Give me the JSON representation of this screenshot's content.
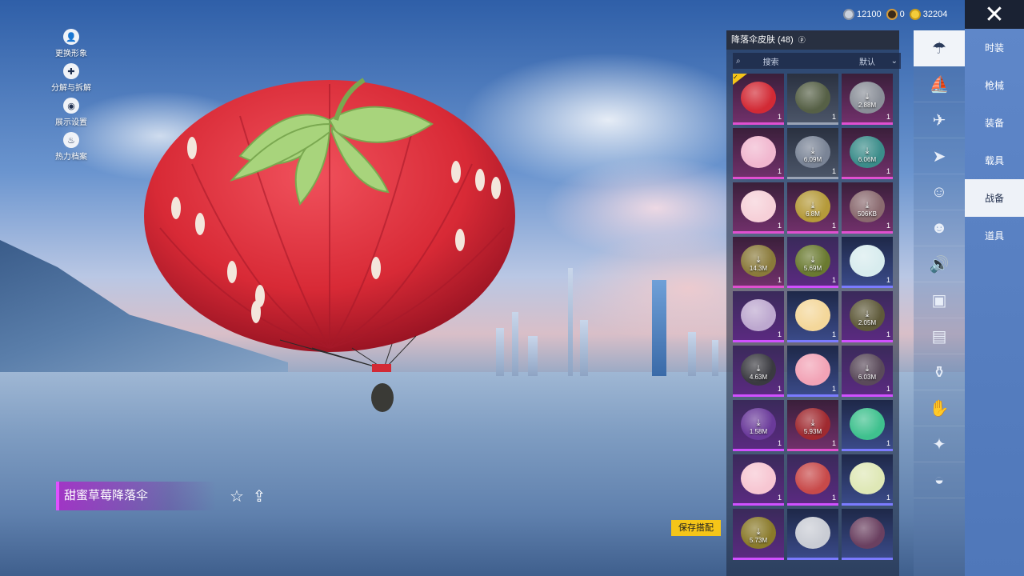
{
  "currency": [
    {
      "icon": "silver-coin-icon",
      "value": "12100",
      "color": "#c9d1dd"
    },
    {
      "icon": "bronze-coin-icon",
      "value": "0",
      "color": "#d49a3a"
    },
    {
      "icon": "gold-coin-icon",
      "value": "32204",
      "color": "#f3cc3a"
    }
  ],
  "left_menu": [
    {
      "icon": "avatar-icon",
      "label": "更换形象"
    },
    {
      "icon": "puzzle-icon",
      "label": "分解与拆解"
    },
    {
      "icon": "eye-icon",
      "label": "展示设置"
    },
    {
      "icon": "fire-icon",
      "label": "热力档案"
    }
  ],
  "item": {
    "name": "甜蜜草莓降落伞"
  },
  "save_button": "保存搭配",
  "panel": {
    "title": "降落伞皮肤 (48)",
    "search_placeholder": "搜索",
    "sort_label": "默认"
  },
  "skins": [
    {
      "style": "magenta",
      "color": "#d22a35",
      "count": "1",
      "download": "",
      "selected": true
    },
    {
      "style": "grey",
      "color": "#566046",
      "count": "1",
      "download": ""
    },
    {
      "style": "magenta",
      "color": "#8a8f98",
      "count": "1",
      "download": "2.88M"
    },
    {
      "style": "magenta",
      "color": "#f1b7cf",
      "count": "1",
      "download": ""
    },
    {
      "style": "grey",
      "color": "#7a8496",
      "count": "1",
      "download": "6.09M"
    },
    {
      "style": "magenta",
      "color": "#3b8d8a",
      "count": "1",
      "download": "6.06M"
    },
    {
      "style": "magenta",
      "color": "#f6d0d8",
      "count": "1",
      "download": ""
    },
    {
      "style": "magenta",
      "color": "#b59a3a",
      "count": "1",
      "download": "6.8M"
    },
    {
      "style": "magenta",
      "color": "#8a6a6f",
      "count": "1",
      "download": "506KB"
    },
    {
      "style": "magenta",
      "color": "#8a7a3a",
      "count": "1",
      "download": "14.3M"
    },
    {
      "style": "purple",
      "color": "#6a7a30",
      "count": "1",
      "download": "5.69M"
    },
    {
      "style": "blue",
      "color": "#d8ecee",
      "count": "1",
      "download": ""
    },
    {
      "style": "purple",
      "color": "#bda8cf",
      "count": "1",
      "download": ""
    },
    {
      "style": "blue",
      "color": "#f4d79a",
      "count": "1",
      "download": ""
    },
    {
      "style": "purple",
      "color": "#5f5a3a",
      "count": "1",
      "download": "2.05M"
    },
    {
      "style": "purple",
      "color": "#3a3a40",
      "count": "1",
      "download": "4.63M"
    },
    {
      "style": "blue",
      "color": "#f2a3b6",
      "count": "1",
      "download": ""
    },
    {
      "style": "purple",
      "color": "#5a4a5a",
      "count": "1",
      "download": "6.03M"
    },
    {
      "style": "purple",
      "color": "#6a3a9a",
      "count": "1",
      "download": "1.58M"
    },
    {
      "style": "magenta",
      "color": "#a02a30",
      "count": "1",
      "download": "5.93M"
    },
    {
      "style": "blue",
      "color": "#3fc18e",
      "count": "1",
      "download": ""
    },
    {
      "style": "purple",
      "color": "#f7c6d2",
      "count": "1",
      "download": ""
    },
    {
      "style": "purple",
      "color": "#c84a4a",
      "count": "1",
      "download": ""
    },
    {
      "style": "blue",
      "color": "#dfe8b6",
      "count": "1",
      "download": ""
    },
    {
      "style": "purple",
      "color": "#8a7a2a",
      "count": "",
      "download": "5.73M"
    },
    {
      "style": "blue",
      "color": "#c9ccd4",
      "count": "",
      "download": ""
    },
    {
      "style": "blue",
      "color": "#6a4060",
      "count": "",
      "download": ""
    }
  ],
  "icon_column": [
    {
      "icon": "parachute-icon",
      "active": true
    },
    {
      "icon": "glider-icon",
      "active": false
    },
    {
      "icon": "plane-icon",
      "active": false
    },
    {
      "icon": "jet-icon",
      "active": false
    },
    {
      "icon": "emote-icon",
      "active": false
    },
    {
      "icon": "companion-icon",
      "active": false
    },
    {
      "icon": "sound-icon",
      "active": false
    },
    {
      "icon": "sticker-icon",
      "active": false
    },
    {
      "icon": "gallery-icon",
      "active": false
    },
    {
      "icon": "fire-extinguisher-icon",
      "active": false
    },
    {
      "icon": "hand-icon",
      "active": false
    },
    {
      "icon": "sparkle-wand-icon",
      "active": false
    },
    {
      "icon": "ufo-icon",
      "active": false
    }
  ],
  "categories": [
    {
      "label": "时装",
      "active": false
    },
    {
      "label": "枪械",
      "active": false
    },
    {
      "label": "装备",
      "active": false
    },
    {
      "label": "载具",
      "active": false
    },
    {
      "label": "战备",
      "active": true
    },
    {
      "label": "道具",
      "active": false
    }
  ]
}
